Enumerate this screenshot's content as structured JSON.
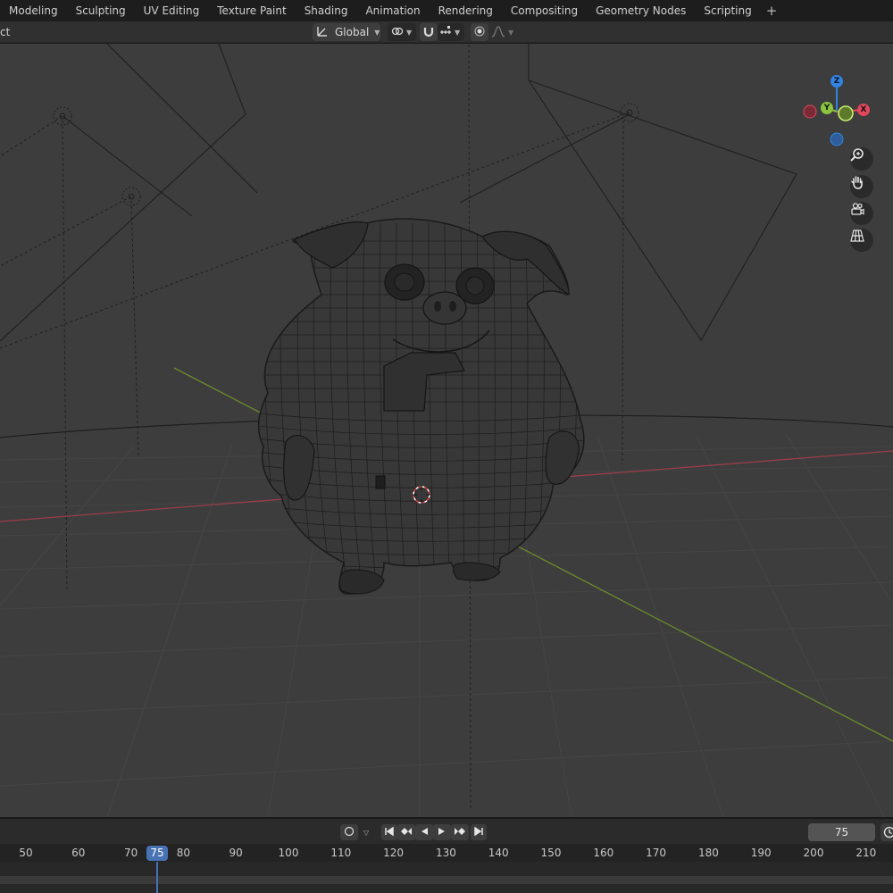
{
  "workspace_tabs": [
    "Modeling",
    "Sculpting",
    "UV Editing",
    "Texture Paint",
    "Shading",
    "Animation",
    "Rendering",
    "Compositing",
    "Geometry Nodes",
    "Scripting"
  ],
  "add_tab_label": "+",
  "header": {
    "clipped_menu_label": "ct",
    "transform_orientation": "Global"
  },
  "gizmo": {
    "z_label": "Z",
    "y_label": "Y",
    "x_label": "X",
    "colors": {
      "x": "#e0475a",
      "y": "#8bc43f",
      "z": "#2f84e3"
    }
  },
  "timeline": {
    "current_frame": "75",
    "frame_field_value": "75",
    "ruler_labels": [
      "50",
      "60",
      "70",
      "80",
      "90",
      "100",
      "110",
      "120",
      "130",
      "140",
      "150",
      "160",
      "170",
      "180",
      "190",
      "200",
      "210"
    ]
  }
}
